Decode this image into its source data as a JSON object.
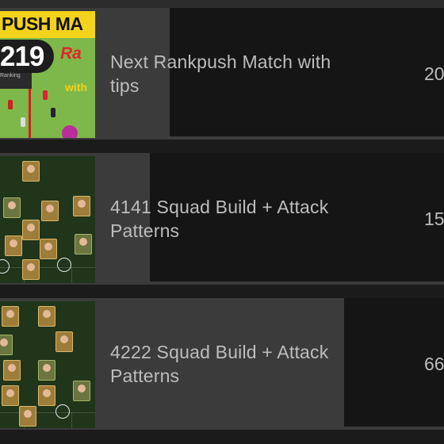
{
  "items": [
    {
      "title": "Next Rankpush Match with tips",
      "count": "20",
      "thumbnail": {
        "banner_text": "PUSH MA",
        "number_text": "219",
        "rating_text": "Ra",
        "ranking_text": "Ranking",
        "with_text": "with"
      }
    },
    {
      "title": "4141 Squad Build + Attack Patterns",
      "count": "15"
    },
    {
      "title": "4222 Squad Build + Attack Patterns",
      "count": "66"
    }
  ],
  "colors": {
    "row_bg": "#3b3b3b",
    "panel_bg": "#151515",
    "text": "#bdbdbd"
  }
}
